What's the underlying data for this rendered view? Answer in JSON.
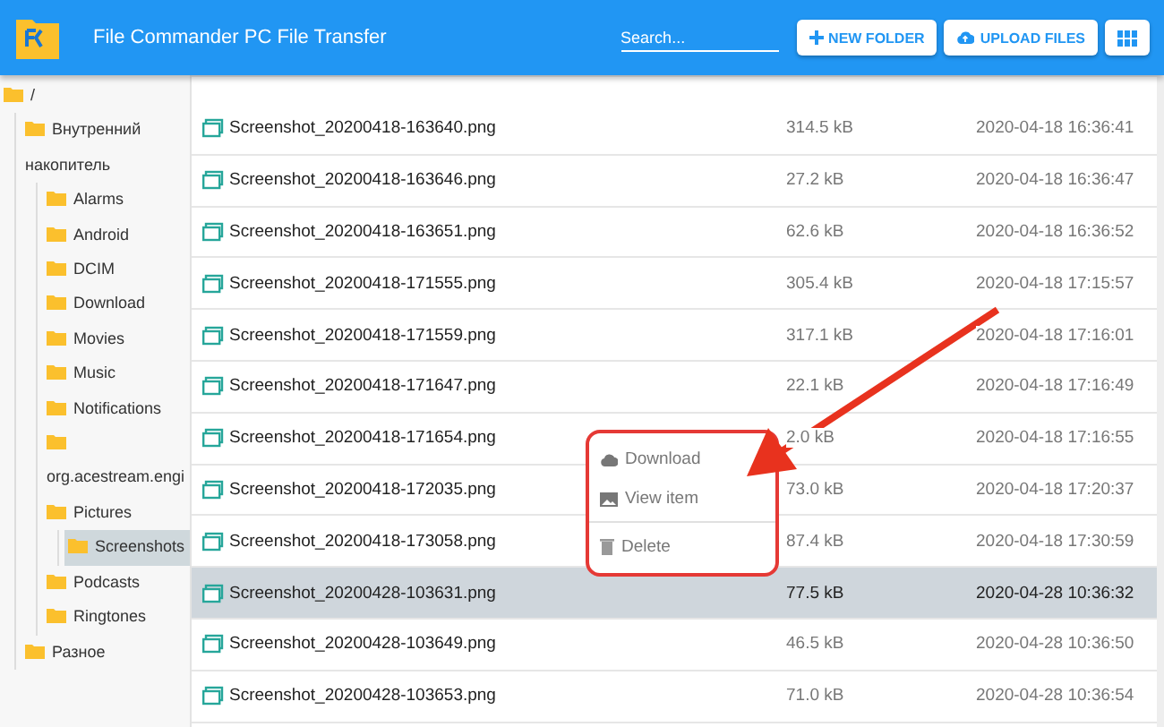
{
  "header": {
    "title": "File Commander PC File Transfer",
    "search": {
      "placeholder": "Search..."
    },
    "buttons": [
      {
        "kind": "new-folder",
        "label": "NEW FOLDER"
      },
      {
        "kind": "upload",
        "label": "UPLOAD FILES"
      },
      {
        "kind": "grid"
      }
    ]
  },
  "sidebar": {
    "tree": [
      {
        "label": "/",
        "selected": false,
        "children": [
          {
            "label": "Внутренний накопитель",
            "selected": false,
            "children": [
              {
                "label": "Alarms",
                "selected": false
              },
              {
                "label": "Android",
                "selected": false
              },
              {
                "label": "DCIM",
                "selected": false
              },
              {
                "label": "Download",
                "selected": false
              },
              {
                "label": "Movies",
                "selected": false
              },
              {
                "label": "Music",
                "selected": false
              },
              {
                "label": "Notifications",
                "selected": false
              },
              {
                "label": "org.acestream.engi",
                "selected": false
              },
              {
                "label": "Pictures",
                "selected": false,
                "children": [
                  {
                    "label": "Screenshots",
                    "selected": true
                  }
                ]
              },
              {
                "label": "Podcasts",
                "selected": false
              },
              {
                "label": "Ringtones",
                "selected": false
              }
            ]
          },
          {
            "label": "Разное",
            "selected": false
          }
        ]
      }
    ]
  },
  "files": [
    {
      "name": "Screenshot_20200418-163640.png",
      "size": "314.5 kB",
      "date": "2020-04-18 16:36:41",
      "selected": false
    },
    {
      "name": "Screenshot_20200418-163646.png",
      "size": "27.2 kB",
      "date": "2020-04-18 16:36:47",
      "selected": false
    },
    {
      "name": "Screenshot_20200418-163651.png",
      "size": "62.6 kB",
      "date": "2020-04-18 16:36:52",
      "selected": false
    },
    {
      "name": "Screenshot_20200418-171555.png",
      "size": "305.4 kB",
      "date": "2020-04-18 17:15:57",
      "selected": false
    },
    {
      "name": "Screenshot_20200418-171559.png",
      "size": "317.1 kB",
      "date": "2020-04-18 17:16:01",
      "selected": false
    },
    {
      "name": "Screenshot_20200418-171647.png",
      "size": "22.1 kB",
      "date": "2020-04-18 17:16:49",
      "selected": false
    },
    {
      "name": "Screenshot_20200418-171654.png",
      "size": "2.0 kB",
      "date": "2020-04-18 17:16:55",
      "selected": false
    },
    {
      "name": "Screenshot_20200418-172035.png",
      "size": "73.0 kB",
      "date": "2020-04-18 17:20:37",
      "selected": false
    },
    {
      "name": "Screenshot_20200418-173058.png",
      "size": "87.4 kB",
      "date": "2020-04-18 17:30:59",
      "selected": false
    },
    {
      "name": "Screenshot_20200428-103631.png",
      "size": "77.5 kB",
      "date": "2020-04-28 10:36:32",
      "selected": true
    },
    {
      "name": "Screenshot_20200428-103649.png",
      "size": "46.5 kB",
      "date": "2020-04-28 10:36:50",
      "selected": false
    },
    {
      "name": "Screenshot_20200428-103653.png",
      "size": "71.0 kB",
      "date": "2020-04-28 10:36:54",
      "selected": false
    }
  ],
  "context_menu": {
    "items": [
      {
        "kind": "download",
        "label": "Download"
      },
      {
        "kind": "view",
        "label": "View item"
      },
      {
        "kind": "delete",
        "label": "Delete"
      }
    ]
  }
}
